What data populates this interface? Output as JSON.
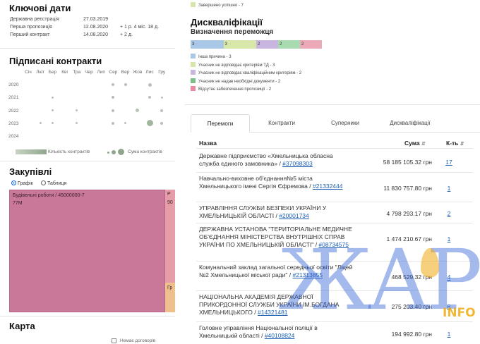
{
  "key_dates": {
    "title": "Ключові дати",
    "rows": [
      {
        "label": "Державна реєстрація",
        "date": "27.03.2019",
        "diff": ""
      },
      {
        "label": "Перша пропозиція",
        "date": "12.08.2020",
        "diff": "+ 1 р. 4 міс. 18 д."
      },
      {
        "label": "Перший контракт",
        "date": "14.08.2020",
        "diff": "+ 2 д."
      }
    ]
  },
  "signed_contracts": {
    "title": "Підписані контракти",
    "months": [
      "Січ",
      "Лют",
      "Бер",
      "Кві",
      "Тра",
      "Чер",
      "Лип",
      "Сер",
      "Вер",
      "Жов",
      "Лис",
      "Гру"
    ],
    "years": [
      "2020",
      "2021",
      "2022",
      "2023",
      "2024"
    ],
    "legend_count": "Кількість контрактів",
    "legend_sum": "Сума контрактів"
  },
  "purchases": {
    "title": "Закупівлі",
    "view_graph": "Графік",
    "view_table": "Таблиця",
    "treemap_label": "Будівельні роботи / 45000000-7",
    "treemap_value": "77M",
    "side_label_1": "Р",
    "side_label_2": "90",
    "side_label_3": "Гр"
  },
  "map": {
    "title": "Карта",
    "checkbox_label": "Немає договорів"
  },
  "completed_legend": "Завершено успішно - 7",
  "disqualifications": {
    "title": "Дискваліфікації",
    "subtitle": "Визначення переможця",
    "bars": [
      {
        "value": "3",
        "color": "#a9c8e8"
      },
      {
        "value": "3",
        "color": "#d7e7a9"
      },
      {
        "value": "2",
        "color": "#c9b6e0"
      },
      {
        "value": "2",
        "color": "#a8dcb0"
      },
      {
        "value": "2",
        "color": "#ecaab8"
      }
    ],
    "legend": [
      {
        "label": "Інша причина - 3",
        "color": "#a9c8e8"
      },
      {
        "label": "Учасник не відповідає критеріям ТД - 3",
        "color": "#d7e7a9"
      },
      {
        "label": "Учасник не відповідає кваліфікаційним критеріям - 2",
        "color": "#c9b6e0"
      },
      {
        "label": "Учасник не надав необхідні документи - 2",
        "color": "#7cc08a"
      },
      {
        "label": "Відсутнє забезпечення пропозиції - 2",
        "color": "#e98aa0"
      }
    ]
  },
  "tabs": [
    "Перемоги",
    "Контракти",
    "Суперники",
    "Дискваліфікації"
  ],
  "table": {
    "headers": {
      "name": "Назва",
      "sum": "Сума",
      "count": "К-ть"
    },
    "rows": [
      {
        "name": "Державне підприємство «Хмельницька обласна служба єдиного замовника» / ",
        "code": "#37098303",
        "sum": "58 185 105.32 грн",
        "count": "17"
      },
      {
        "name": "Навчально-виховне об'єднання№5 міста Хмельницького імені Сергія Єфремова / ",
        "code": "#21332444",
        "sum": "11 830 757.80 грн",
        "count": "1"
      },
      {
        "name": "УПРАВЛІННЯ СЛУЖБИ БЕЗПЕКИ УКРАЇНИ У ХМЕЛЬНИЦЬКІЙ ОБЛАСТІ / ",
        "code": "#20001734",
        "sum": "4 798 293.17 грн",
        "count": "2"
      },
      {
        "name": "ДЕРЖАВНА УСТАНОВА \"ТЕРИТОРІАЛЬНЕ МЕДИЧНЕ ОБ'ЄДНАННЯ МІНІСТЕРСТВА ВНУТРІШНІХ СПРАВ УКРАЇНИ ПО ХМЕЛЬНИЦЬКІЙ ОБЛАСТІ\" / ",
        "code": "#08734575",
        "sum": "1 474 210.67 грн",
        "count": "1"
      },
      {
        "name": "Комунальний заклад загальної середньої освіти \"Ліцей №2 Хмельницької міської ради\" / ",
        "code": "#21313855",
        "sum": "468 529.32 грн",
        "count": "4"
      },
      {
        "name": "НАЦІОНАЛЬНА АКАДЕМІЯ ДЕРЖАВНОЇ ПРИКОРДОННОЇ СЛУЖБИ УКРАЇНИ ІМ.БОГДАНА ХМЕЛЬНИЦЬКОГО / ",
        "code": "#14321481",
        "sum": "275 203.40 грн",
        "count": "6"
      },
      {
        "name": "Головне управління Національної поліції в Хмельницькій області / ",
        "code": "#40108824",
        "sum": "194 992.80 грн",
        "count": "1"
      }
    ]
  },
  "watermark": {
    "text": "ЖАР",
    "suffix": "INFO"
  }
}
